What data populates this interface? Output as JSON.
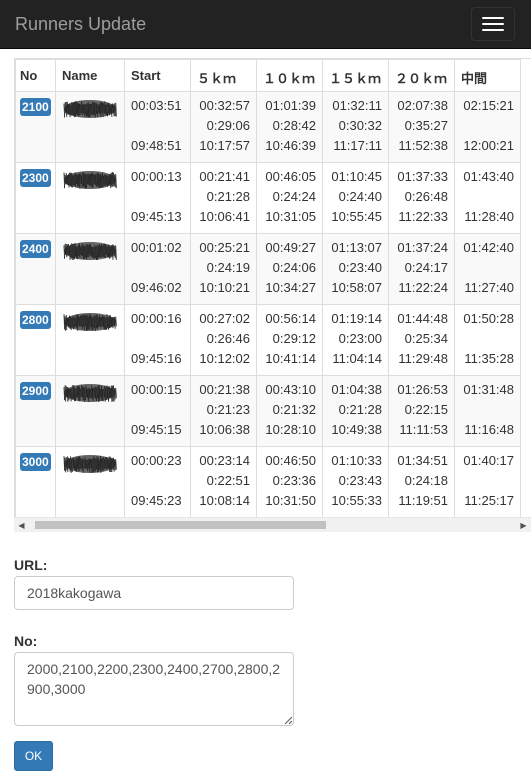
{
  "app": {
    "title": "Runners Update"
  },
  "table": {
    "headers": [
      "No",
      "Name",
      "Start",
      "５ｋｍ",
      "１０ｋｍ",
      "１５ｋｍ",
      "２０ｋｍ",
      "中間"
    ],
    "rows": [
      {
        "no": "2100",
        "start": [
          "00:03:51",
          "",
          "09:48:51"
        ],
        "splits": [
          [
            "00:32:57",
            "0:29:06",
            "10:17:57"
          ],
          [
            "01:01:39",
            "0:28:42",
            "10:46:39"
          ],
          [
            "01:32:11",
            "0:30:32",
            "11:17:11"
          ],
          [
            "02:07:38",
            "0:35:27",
            "11:52:38"
          ],
          [
            "02:15:21",
            "",
            "12:00:21"
          ]
        ]
      },
      {
        "no": "2300",
        "start": [
          "00:00:13",
          "",
          "09:45:13"
        ],
        "splits": [
          [
            "00:21:41",
            "0:21:28",
            "10:06:41"
          ],
          [
            "00:46:05",
            "0:24:24",
            "10:31:05"
          ],
          [
            "01:10:45",
            "0:24:40",
            "10:55:45"
          ],
          [
            "01:37:33",
            "0:26:48",
            "11:22:33"
          ],
          [
            "01:43:40",
            "",
            "11:28:40"
          ]
        ]
      },
      {
        "no": "2400",
        "start": [
          "00:01:02",
          "",
          "09:46:02"
        ],
        "splits": [
          [
            "00:25:21",
            "0:24:19",
            "10:10:21"
          ],
          [
            "00:49:27",
            "0:24:06",
            "10:34:27"
          ],
          [
            "01:13:07",
            "0:23:40",
            "10:58:07"
          ],
          [
            "01:37:24",
            "0:24:17",
            "11:22:24"
          ],
          [
            "01:42:40",
            "",
            "11:27:40"
          ]
        ]
      },
      {
        "no": "2800",
        "start": [
          "00:00:16",
          "",
          "09:45:16"
        ],
        "splits": [
          [
            "00:27:02",
            "0:26:46",
            "10:12:02"
          ],
          [
            "00:56:14",
            "0:29:12",
            "10:41:14"
          ],
          [
            "01:19:14",
            "0:23:00",
            "11:04:14"
          ],
          [
            "01:44:48",
            "0:25:34",
            "11:29:48"
          ],
          [
            "01:50:28",
            "",
            "11:35:28"
          ]
        ]
      },
      {
        "no": "2900",
        "start": [
          "00:00:15",
          "",
          "09:45:15"
        ],
        "splits": [
          [
            "00:21:38",
            "0:21:23",
            "10:06:38"
          ],
          [
            "00:43:10",
            "0:21:32",
            "10:28:10"
          ],
          [
            "01:04:38",
            "0:21:28",
            "10:49:38"
          ],
          [
            "01:26:53",
            "0:22:15",
            "11:11:53"
          ],
          [
            "01:31:48",
            "",
            "11:16:48"
          ]
        ]
      },
      {
        "no": "3000",
        "start": [
          "00:00:23",
          "",
          "09:45:23"
        ],
        "splits": [
          [
            "00:23:14",
            "0:22:51",
            "10:08:14"
          ],
          [
            "00:46:50",
            "0:23:36",
            "10:31:50"
          ],
          [
            "01:10:33",
            "0:23:43",
            "10:55:33"
          ],
          [
            "01:34:51",
            "0:24:18",
            "11:19:51"
          ],
          [
            "01:40:17",
            "",
            "11:25:17"
          ]
        ]
      }
    ]
  },
  "form": {
    "url_label": "URL:",
    "url_value": "2018kakogawa",
    "no_label": "No:",
    "no_value": "2000,2100,2200,2300,2400,2700,2800,2900,3000",
    "ok_label": "OK"
  },
  "colors": {
    "navbar": "#222222",
    "brand_text": "#9d9d9d",
    "primary": "#337ab7",
    "stripe": "#f9f9f9"
  },
  "icons": {
    "menu": "hamburger-menu-icon",
    "scroll_left": "scroll-left-arrow-icon",
    "scroll_right": "scroll-right-arrow-icon"
  }
}
